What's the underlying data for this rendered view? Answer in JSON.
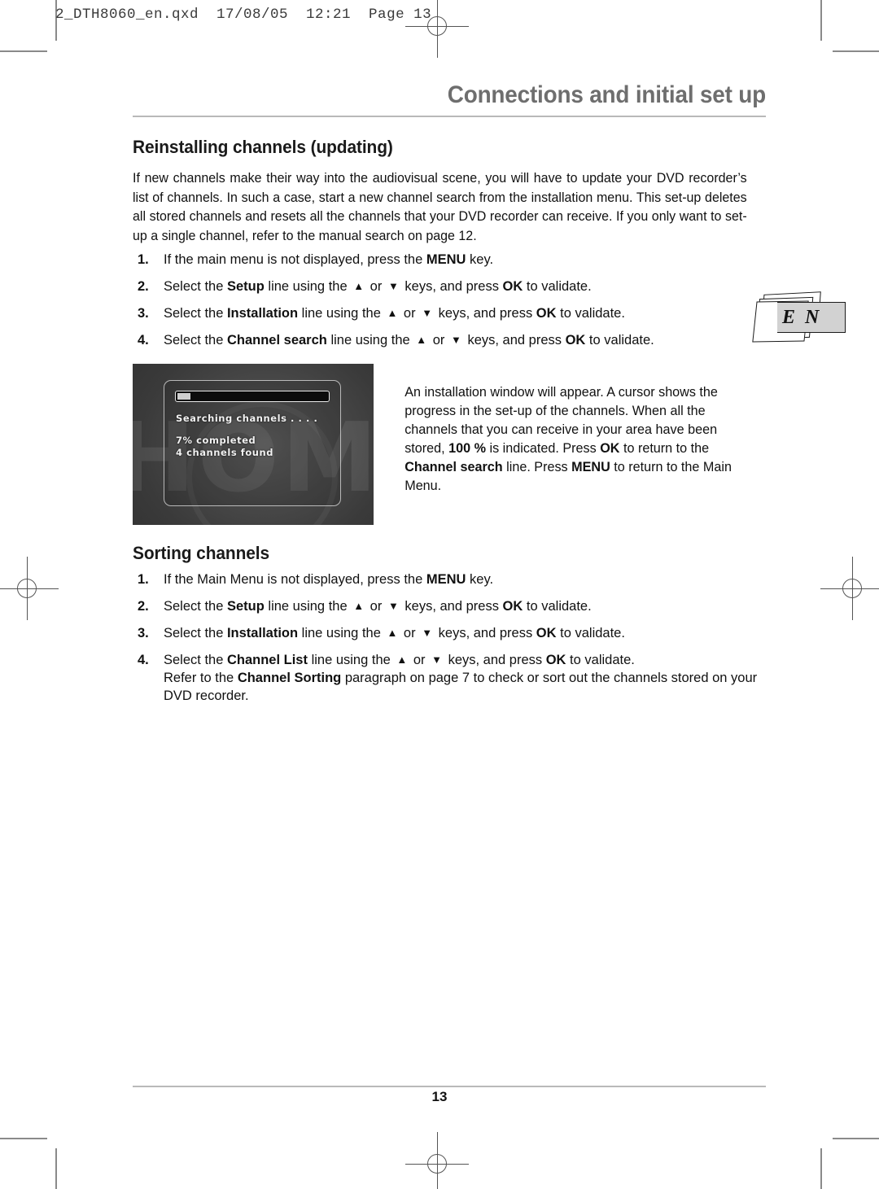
{
  "prepress": {
    "header_text": "2_DTH8060_en.qxd  17/08/05  12:21  Page 13"
  },
  "document": {
    "title": "Connections and initial set up",
    "page_number": "13",
    "language_tab": "E N"
  },
  "sections": [
    {
      "heading": "Reinstalling channels (updating)",
      "intro": "If new channels make their way into the audiovisual scene, you will have to update your DVD recorder’s list of channels. In such a case, start a new channel search from the installation menu. This set-up deletes all stored channels and resets all the channels that your DVD recorder can receive. If you only want to set-up a single channel, refer to the manual search on page 12.",
      "steps": [
        {
          "num": "1.",
          "parts": [
            {
              "t": "If the main menu is not displayed, press the ",
              "bold": false
            },
            {
              "t": "MENU",
              "bold": true
            },
            {
              "t": " key.",
              "bold": false
            }
          ]
        },
        {
          "num": "2.",
          "parts": [
            {
              "t": "Select the ",
              "bold": false
            },
            {
              "t": "Setup",
              "bold": true
            },
            {
              "t": " line using the ",
              "bold": false
            },
            {
              "t": "▲",
              "arrow": true
            },
            {
              "t": " or ",
              "bold": false
            },
            {
              "t": "▼",
              "arrow": true
            },
            {
              "t": " keys, and press ",
              "bold": false
            },
            {
              "t": "OK",
              "bold": true
            },
            {
              "t": " to validate.",
              "bold": false
            }
          ]
        },
        {
          "num": "3.",
          "parts": [
            {
              "t": "Select the ",
              "bold": false
            },
            {
              "t": "Installation",
              "bold": true
            },
            {
              "t": " line using the ",
              "bold": false
            },
            {
              "t": "▲",
              "arrow": true
            },
            {
              "t": " or ",
              "bold": false
            },
            {
              "t": "▼",
              "arrow": true
            },
            {
              "t": " keys, and press ",
              "bold": false
            },
            {
              "t": "OK",
              "bold": true
            },
            {
              "t": " to validate.",
              "bold": false
            }
          ]
        },
        {
          "num": "4.",
          "parts": [
            {
              "t": "Select the ",
              "bold": false
            },
            {
              "t": "Channel search",
              "bold": true
            },
            {
              "t": " line using the ",
              "bold": false
            },
            {
              "t": "▲",
              "arrow": true
            },
            {
              "t": " or ",
              "bold": false
            },
            {
              "t": "▼",
              "arrow": true
            },
            {
              "t": " keys, and press ",
              "bold": false
            },
            {
              "t": "OK",
              "bold": true
            },
            {
              "t": " to validate.",
              "bold": false
            }
          ]
        }
      ],
      "figure": {
        "screen": {
          "watermark": "HOMSO",
          "progress_percent": 7,
          "progress_label": "Searching channels . . . .",
          "completed_line": "7% completed",
          "found_line": "4 channels found"
        },
        "caption_parts": [
          {
            "t": "An installation window will appear. A cursor shows the progress in the set-up of the channels. When all the channels that you can receive in your area have been stored, ",
            "bold": false
          },
          {
            "t": "100 %",
            "bold": true
          },
          {
            "t": " is indicated. Press ",
            "bold": false
          },
          {
            "t": "OK",
            "bold": true
          },
          {
            "t": " to return to the ",
            "bold": false
          },
          {
            "t": "Channel search",
            "bold": true
          },
          {
            "t": " line. Press ",
            "bold": false
          },
          {
            "t": "MENU",
            "bold": true
          },
          {
            "t": " to return to the Main Menu.",
            "bold": false
          }
        ]
      }
    },
    {
      "heading": "Sorting channels",
      "steps": [
        {
          "num": "1.",
          "parts": [
            {
              "t": "If the Main Menu is not displayed, press the ",
              "bold": false
            },
            {
              "t": "MENU",
              "bold": true
            },
            {
              "t": " key.",
              "bold": false
            }
          ]
        },
        {
          "num": "2.",
          "parts": [
            {
              "t": "Select the ",
              "bold": false
            },
            {
              "t": "Setup",
              "bold": true
            },
            {
              "t": " line using the ",
              "bold": false
            },
            {
              "t": "▲",
              "arrow": true
            },
            {
              "t": " or ",
              "bold": false
            },
            {
              "t": "▼",
              "arrow": true
            },
            {
              "t": " keys, and press ",
              "bold": false
            },
            {
              "t": "OK",
              "bold": true
            },
            {
              "t": " to validate.",
              "bold": false
            }
          ]
        },
        {
          "num": "3.",
          "parts": [
            {
              "t": "Select the ",
              "bold": false
            },
            {
              "t": "Installation",
              "bold": true
            },
            {
              "t": " line using the ",
              "bold": false
            },
            {
              "t": "▲",
              "arrow": true
            },
            {
              "t": " or ",
              "bold": false
            },
            {
              "t": "▼",
              "arrow": true
            },
            {
              "t": " keys, and press ",
              "bold": false
            },
            {
              "t": "OK",
              "bold": true
            },
            {
              "t": " to validate.",
              "bold": false
            }
          ]
        },
        {
          "num": "4.",
          "parts": [
            {
              "t": "Select the ",
              "bold": false
            },
            {
              "t": "Channel List",
              "bold": true
            },
            {
              "t": " line using the ",
              "bold": false
            },
            {
              "t": "▲",
              "arrow": true
            },
            {
              "t": " or ",
              "bold": false
            },
            {
              "t": "▼",
              "arrow": true
            },
            {
              "t": " keys, and press ",
              "bold": false
            },
            {
              "t": "OK",
              "bold": true
            },
            {
              "t": " to validate.",
              "bold": false
            },
            {
              "t": "\n",
              "br": true
            },
            {
              "t": "Refer to the ",
              "bold": false
            },
            {
              "t": "Channel Sorting",
              "bold": true
            },
            {
              "t": " paragraph on page 7 to check or sort out the channels stored on your DVD recorder.",
              "bold": false
            }
          ]
        }
      ]
    }
  ],
  "colors": {
    "title_gray": "#6e6e6e",
    "rule_gray": "#b9b9b9",
    "body_black": "#111111",
    "tab_gray": "#d2d2d2"
  }
}
